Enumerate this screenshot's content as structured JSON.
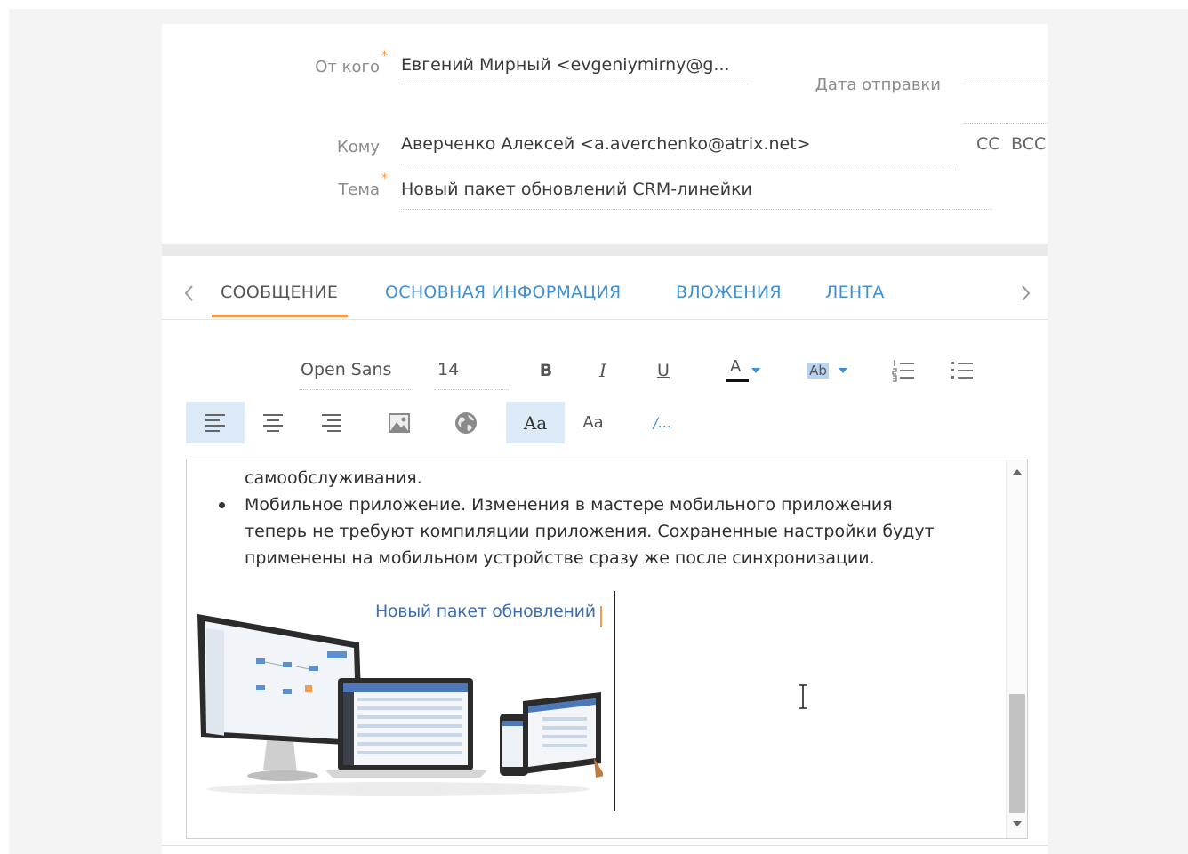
{
  "header": {
    "from_label": "От кого",
    "from_value": "Евгений Мирный <evgeniymirny@g...",
    "send_date_label": "Дата отправки",
    "to_label": "Кому",
    "to_value": "Аверченко Алексей <a.averchenko@atrix.net>",
    "cc_label": "CC",
    "bcc_label": "BCC",
    "subject_label": "Тема",
    "subject_value": "Новый пакет обновлений CRM-линейки",
    "required_mark": "*"
  },
  "tabs": [
    {
      "label": "СООБЩЕНИЕ",
      "active": true
    },
    {
      "label": "ОСНОВНАЯ ИНФОРМАЦИЯ",
      "active": false
    },
    {
      "label": "ВЛОЖЕНИЯ",
      "active": false
    },
    {
      "label": "ЛЕНТА",
      "active": false
    }
  ],
  "toolbar": {
    "font_family": "Open Sans",
    "font_size": "14",
    "bold": "B",
    "italic": "I",
    "underline": "U",
    "font_color": "A",
    "highlight": "Ab",
    "text_style_serif": "Aa",
    "text_style_sans": "Aa",
    "clear_format": "/..."
  },
  "editor": {
    "line0": "самообслуживания.",
    "bullet_line1": "Мобильное приложение. Изменения в мастере мобильного приложения",
    "bullet_line2": "теперь не требуют компиляции приложения. Сохраненные настройки будут",
    "bullet_line3": "применены на мобильном устройстве сразу же после синхронизации.",
    "image_caption": "Новый пакет обновлений"
  },
  "colors": {
    "accent_orange": "#f29b51",
    "link_blue": "#3f8fd2",
    "active_tool_bg": "#dce9f7"
  }
}
